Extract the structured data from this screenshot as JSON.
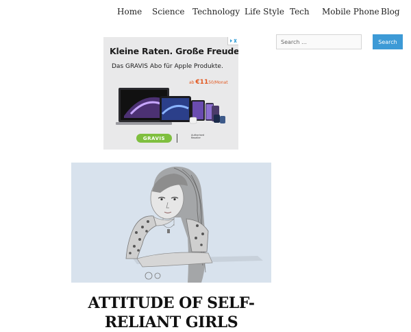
{
  "nav": {
    "items": [
      "Home",
      "Science",
      "Technology",
      "Life Style",
      "Tech",
      "Mobile Phone",
      "Blog"
    ]
  },
  "ad": {
    "headline": "Kleine Raten. Große Freude.",
    "subline": "Das GRAVIS Abo für Apple Produkte.",
    "price_prefix": "ab",
    "price_value": "€11",
    "price_suffix": "50/Monat",
    "brand": "GRAVIS",
    "authorized": "Authorised Reseller",
    "accent_color": "#e2571e",
    "brand_color": "#7fbf3f"
  },
  "post": {
    "title": "ATTITUDE OF SELF-RELIANT GIRLS"
  },
  "search": {
    "placeholder": "Search …",
    "button_label": "Search",
    "button_color": "#3d9ad6"
  }
}
